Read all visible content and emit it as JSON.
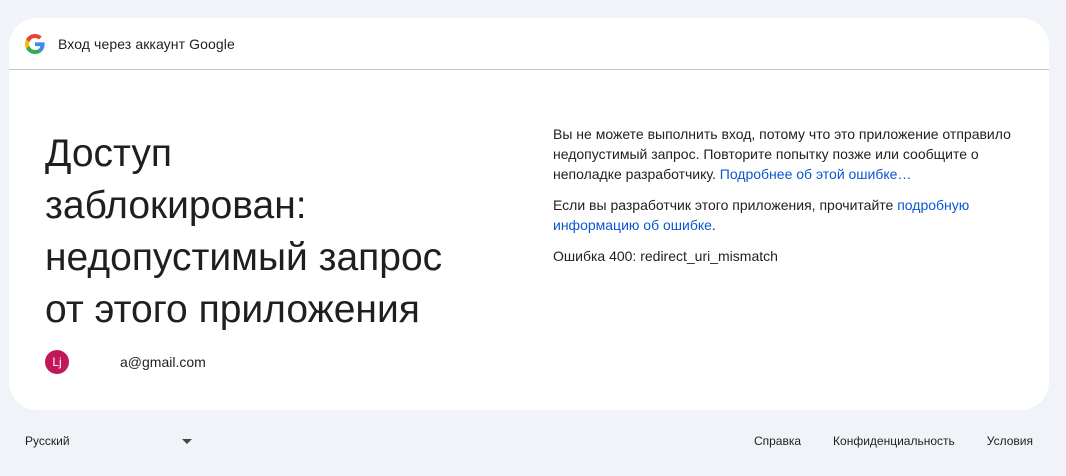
{
  "header": {
    "logo_icon": "google-g-icon",
    "title": "Вход через аккаунт Google"
  },
  "main": {
    "headline_lines": [
      "Доступ",
      "заблокирован:",
      "недопустимый запрос",
      "от этого приложения"
    ],
    "account": {
      "avatar_initials": "Lj",
      "avatar_color": "#c2185b",
      "email": "a@gmail.com"
    },
    "description": {
      "text": "Вы не можете выполнить вход, потому что это приложение отправило недопустимый запрос. Повторите попытку позже или сообщите о неполадке разработчику.",
      "link": "Подробнее об этой ошибке…"
    },
    "developer_note": {
      "text": "Если вы разработчик этого приложения, прочитайте",
      "link": "подробную информацию об ошибке",
      "suffix": "."
    },
    "error_code": "Ошибка 400: redirect_uri_mismatch"
  },
  "footer": {
    "language": "Русский",
    "links": [
      "Справка",
      "Конфиденциальность",
      "Условия"
    ]
  },
  "colors": {
    "page_bg": "#f0f4f9",
    "link": "#0b57d0",
    "text": "#1f1f1f"
  }
}
